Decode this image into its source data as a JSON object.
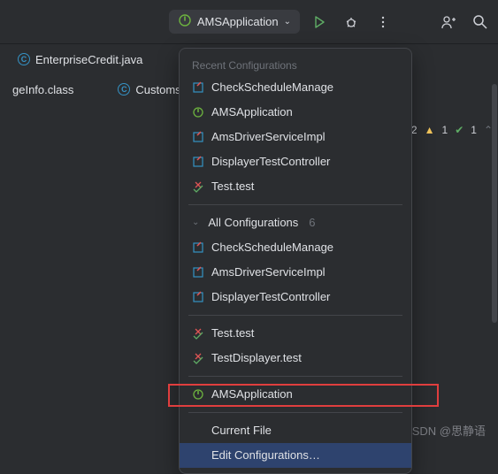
{
  "toolbar": {
    "selected_config": "AMSApplication"
  },
  "tabs": {
    "row1": [
      {
        "label": "EnterpriseCredit.java"
      }
    ],
    "row2": [
      {
        "label": "geInfo.class"
      },
      {
        "label": "Customs"
      }
    ]
  },
  "dropdown": {
    "recent_header": "Recent Configurations",
    "recent": [
      {
        "label": "CheckScheduleManage",
        "icon": "config"
      },
      {
        "label": "AMSApplication",
        "icon": "spring"
      },
      {
        "label": "AmsDriverServiceImpl",
        "icon": "config"
      },
      {
        "label": "DisplayerTestController",
        "icon": "config"
      },
      {
        "label": "Test.test",
        "icon": "test"
      }
    ],
    "all_header": "All Configurations",
    "all_count": "6",
    "all": [
      {
        "label": "CheckScheduleManage",
        "icon": "config"
      },
      {
        "label": "AmsDriverServiceImpl",
        "icon": "config"
      },
      {
        "label": "DisplayerTestController",
        "icon": "config"
      },
      {
        "label": "Test.test",
        "icon": "test"
      },
      {
        "label": "TestDisplayer.test",
        "icon": "test"
      },
      {
        "label": "AMSApplication",
        "icon": "spring"
      }
    ],
    "current_file": "Current File",
    "edit_config": "Edit Configurations…"
  },
  "status": {
    "errors": "2",
    "warnings": "1",
    "ok": "1"
  },
  "watermark": "CSDN @思静语"
}
